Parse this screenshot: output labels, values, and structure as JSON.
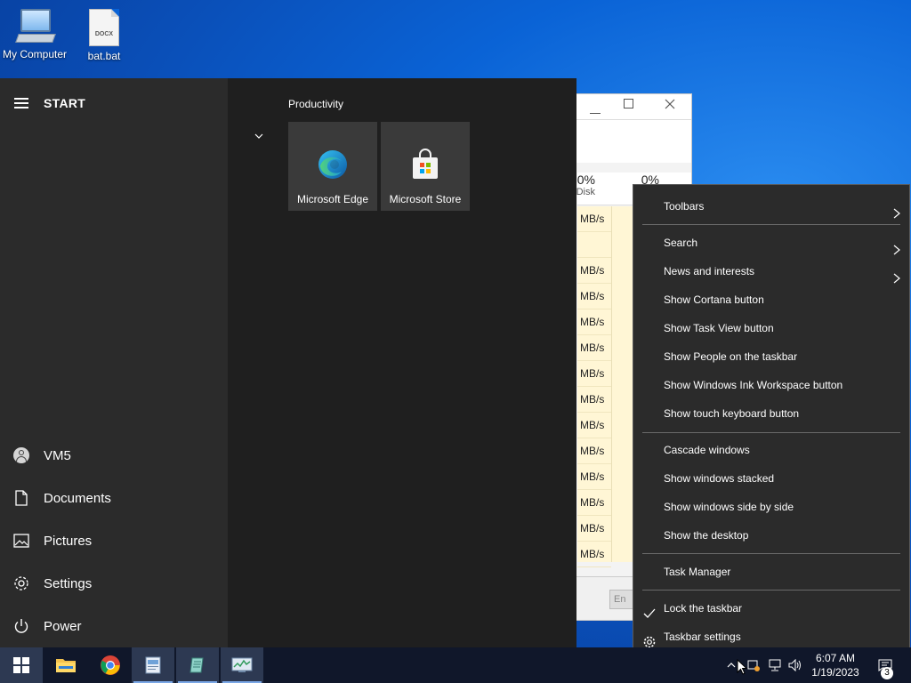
{
  "desktop": {
    "icons": [
      {
        "label": "My Computer",
        "icon": "computer-icon"
      },
      {
        "label": "bat.bat",
        "icon": "docx-file-icon",
        "badge": "DOCX"
      }
    ]
  },
  "task_manager": {
    "columns": [
      {
        "pct": "0%",
        "label": "Disk"
      },
      {
        "pct": "0%",
        "label": "N"
      }
    ],
    "disk_rows": [
      "MB/s",
      "",
      "MB/s",
      "MB/s",
      "MB/s",
      "MB/s",
      "MB/s",
      "MB/s",
      "MB/s",
      "MB/s",
      "MB/s",
      "MB/s",
      "MB/s",
      "MB/s"
    ],
    "end_button": "En"
  },
  "start_menu": {
    "title": "START",
    "user": "VM5",
    "items": {
      "documents": "Documents",
      "pictures": "Pictures",
      "settings": "Settings",
      "power": "Power"
    },
    "group_title": "Productivity",
    "tiles": [
      {
        "label": "Microsoft Edge",
        "icon": "edge-icon"
      },
      {
        "label": "Microsoft Store",
        "icon": "store-icon"
      }
    ]
  },
  "context_menu": {
    "items": {
      "toolbars": "Toolbars",
      "search": "Search",
      "news": "News and interests",
      "cortana": "Show Cortana button",
      "task_view": "Show Task View button",
      "people": "Show People on the taskbar",
      "ink": "Show Windows Ink Workspace button",
      "touch_kb": "Show touch keyboard button",
      "cascade": "Cascade windows",
      "stacked": "Show windows stacked",
      "side_by_side": "Show windows side by side",
      "desktop": "Show the desktop",
      "task_manager": "Task Manager",
      "lock": "Lock the taskbar",
      "tb_settings": "Taskbar settings"
    },
    "checked": [
      "lock"
    ]
  },
  "taskbar": {
    "clock_time": "6:07 AM",
    "clock_date": "1/19/2023",
    "notification_count": "3",
    "colors": {
      "bg": "#10172a",
      "accent": "#1a7cf0"
    }
  }
}
